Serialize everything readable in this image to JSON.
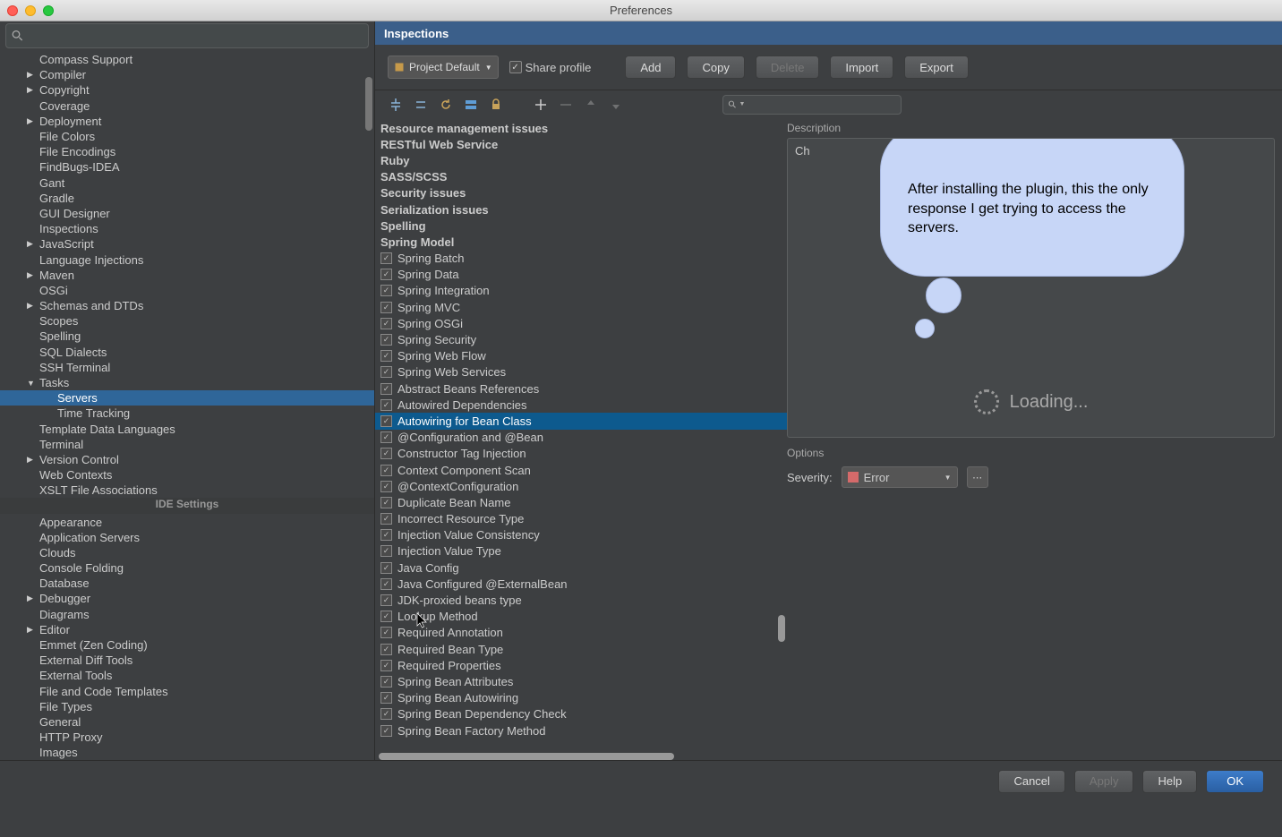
{
  "window": {
    "title": "Preferences"
  },
  "sidebar": {
    "search_placeholder": "",
    "items": [
      {
        "label": "Compass Support",
        "arrow": ""
      },
      {
        "label": "Compiler",
        "arrow": "▶"
      },
      {
        "label": "Copyright",
        "arrow": "▶"
      },
      {
        "label": "Coverage",
        "arrow": ""
      },
      {
        "label": "Deployment",
        "arrow": "▶"
      },
      {
        "label": "File Colors",
        "arrow": ""
      },
      {
        "label": "File Encodings",
        "arrow": ""
      },
      {
        "label": "FindBugs-IDEA",
        "arrow": ""
      },
      {
        "label": "Gant",
        "arrow": ""
      },
      {
        "label": "Gradle",
        "arrow": ""
      },
      {
        "label": "GUI Designer",
        "arrow": ""
      },
      {
        "label": "Inspections",
        "arrow": ""
      },
      {
        "label": "JavaScript",
        "arrow": "▶"
      },
      {
        "label": "Language Injections",
        "arrow": ""
      },
      {
        "label": "Maven",
        "arrow": "▶"
      },
      {
        "label": "OSGi",
        "arrow": ""
      },
      {
        "label": "Schemas and DTDs",
        "arrow": "▶"
      },
      {
        "label": "Scopes",
        "arrow": ""
      },
      {
        "label": "Spelling",
        "arrow": ""
      },
      {
        "label": "SQL Dialects",
        "arrow": ""
      },
      {
        "label": "SSH Terminal",
        "arrow": ""
      },
      {
        "label": "Tasks",
        "arrow": "▼"
      },
      {
        "label": "Servers",
        "arrow": "",
        "indent": 2,
        "selected": true
      },
      {
        "label": "Time Tracking",
        "arrow": "",
        "indent": 2
      },
      {
        "label": "Template Data Languages",
        "arrow": ""
      },
      {
        "label": "Terminal",
        "arrow": ""
      },
      {
        "label": "Version Control",
        "arrow": "▶"
      },
      {
        "label": "Web Contexts",
        "arrow": ""
      },
      {
        "label": "XSLT File Associations",
        "arrow": ""
      }
    ],
    "section_header": "IDE Settings",
    "items2": [
      {
        "label": "Appearance",
        "arrow": ""
      },
      {
        "label": "Application Servers",
        "arrow": ""
      },
      {
        "label": "Clouds",
        "arrow": ""
      },
      {
        "label": "Console Folding",
        "arrow": ""
      },
      {
        "label": "Database",
        "arrow": ""
      },
      {
        "label": "Debugger",
        "arrow": "▶"
      },
      {
        "label": "Diagrams",
        "arrow": ""
      },
      {
        "label": "Editor",
        "arrow": "▶"
      },
      {
        "label": "Emmet (Zen Coding)",
        "arrow": ""
      },
      {
        "label": "External Diff Tools",
        "arrow": ""
      },
      {
        "label": "External Tools",
        "arrow": ""
      },
      {
        "label": "File and Code Templates",
        "arrow": ""
      },
      {
        "label": "File Types",
        "arrow": ""
      },
      {
        "label": "General",
        "arrow": ""
      },
      {
        "label": "HTTP Proxy",
        "arrow": ""
      },
      {
        "label": "Images",
        "arrow": ""
      }
    ]
  },
  "main": {
    "header": "Inspections",
    "profile_combo": "Project Default",
    "share_profile": "Share profile",
    "buttons": {
      "add": "Add",
      "copy": "Copy",
      "delete": "Delete",
      "import": "Import",
      "export": "Export"
    }
  },
  "inspections": {
    "groups": [
      "Resource management issues",
      "RESTful Web Service",
      "Ruby",
      "SASS/SCSS",
      "Security issues",
      "Serialization issues",
      "Spelling",
      "Spring Model"
    ],
    "children": [
      "Spring Batch",
      "Spring Data",
      "Spring Integration",
      "Spring MVC",
      "Spring OSGi",
      "Spring Security",
      "Spring Web Flow",
      "Spring Web Services",
      "Abstract Beans References",
      "Autowired Dependencies",
      "Autowiring for Bean Class",
      "@Configuration and @Bean",
      "Constructor Tag Injection",
      "Context Component Scan",
      "@ContextConfiguration",
      "Duplicate Bean Name",
      "Incorrect Resource Type",
      "Injection Value Consistency",
      "Injection Value Type",
      "Java Config",
      "Java Configured @ExternalBean",
      "JDK-proxied beans type",
      "Lookup Method",
      "Required Annotation",
      "Required Bean Type",
      "Required Properties",
      "Spring Bean Attributes",
      "Spring Bean Autowiring",
      "Spring Bean Dependency Check",
      "Spring Bean Factory Method"
    ],
    "selected_index": 10
  },
  "description": {
    "label": "Description",
    "truncated": "Ch",
    "loading": "Loading...",
    "cloud_text": "After installing the plugin, this the only response I get trying to access the servers."
  },
  "options": {
    "label": "Options",
    "severity_label": "Severity:",
    "severity_value": "Error"
  },
  "footer": {
    "cancel": "Cancel",
    "apply": "Apply",
    "help": "Help",
    "ok": "OK"
  }
}
